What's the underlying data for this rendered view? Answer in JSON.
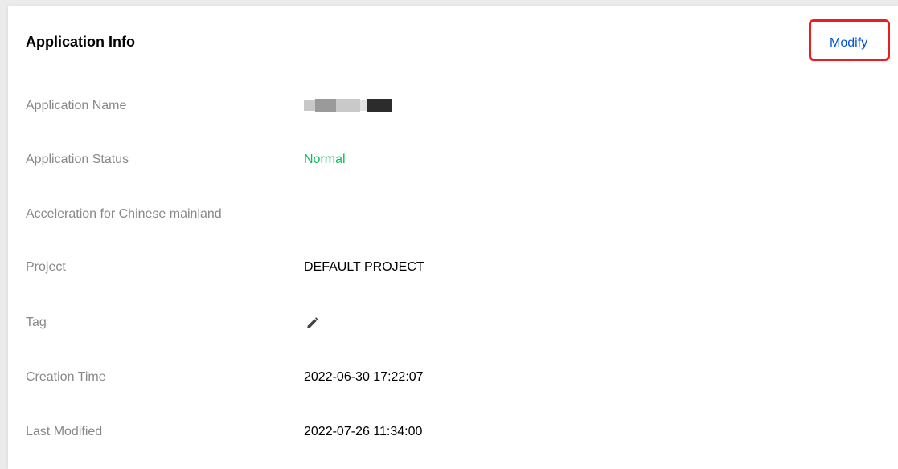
{
  "panel": {
    "title": "Application Info",
    "modify_label": "Modify",
    "highlight_color": "#ee1d1d",
    "link_color": "#0052d9"
  },
  "fields": [
    {
      "label": "Application Name",
      "value": ""
    },
    {
      "label": "Application Status",
      "value": "Normal",
      "color": "#0abf5b"
    },
    {
      "label": "Acceleration for Chinese mainland",
      "value": ""
    },
    {
      "label": "Project",
      "value": "DEFAULT PROJECT"
    },
    {
      "label": "Tag",
      "value": "",
      "icon": "pencil-edit-icon"
    },
    {
      "label": "Creation Time",
      "value": "2022-06-30 17:22:07"
    },
    {
      "label": "Last Modified",
      "value": "2022-07-26 11:34:00"
    }
  ]
}
